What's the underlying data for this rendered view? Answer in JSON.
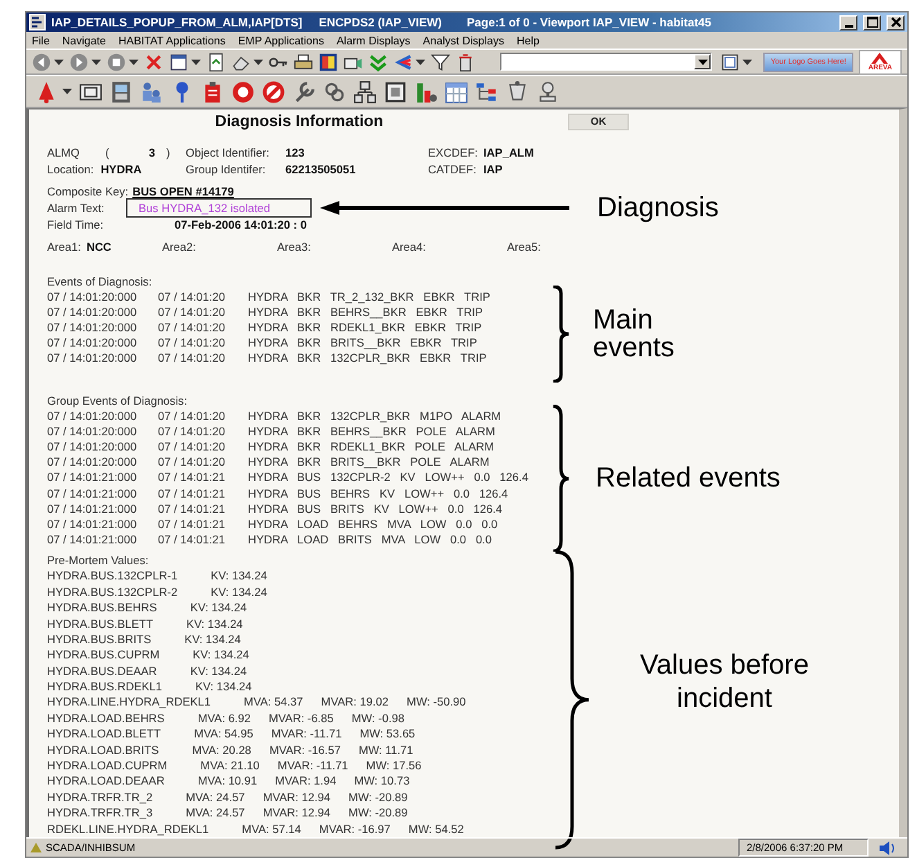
{
  "window": {
    "title": "IAP_DETAILS_POPUP_FROM_ALM,IAP[DTS]",
    "view": "ENCPDS2 (IAP_VIEW)",
    "page_info": "Page:1 of 0  - Viewport IAP_VIEW - habitat45"
  },
  "menu": [
    "File",
    "Navigate",
    "HABITAT Applications",
    "EMP Applications",
    "Alarm Displays",
    "Analyst Displays",
    "Help"
  ],
  "toolbar": {
    "logo_text": "Your Logo Goes Here!",
    "brand": "AREVA"
  },
  "dialog": {
    "title": "Diagnosis Information",
    "ok_button": "OK",
    "identifiers": [
      [
        {
          "label": "ALMQ",
          "open": "(",
          "value": "3",
          "close": ")"
        },
        {
          "label": "Object Identifier:",
          "value": "123"
        },
        {
          "label": "EXCDEF:",
          "value": "IAP_ALM"
        }
      ],
      [
        {
          "label": "Location:",
          "value": "HYDRA"
        },
        {
          "label": "Group Identifer:",
          "value": "62213505051"
        },
        {
          "label": "CATDEF:",
          "value": "IAP"
        }
      ]
    ],
    "composite_key": {
      "label": "Composite Key:",
      "value": "BUS OPEN #14179"
    },
    "alarm_text": {
      "label": "Alarm Text:",
      "value": "Bus HYDRA_132  isolated",
      "annotation": {
        "kind": "arrow",
        "label": "Diagnosis"
      }
    },
    "field_time": {
      "label": "Field Time:",
      "value": "07-Feb-2006 14:01:20 : 0"
    },
    "areas": [
      {
        "label": "Area1:",
        "value": "NCC"
      },
      {
        "label": "Area2:"
      },
      {
        "label": "Area3:"
      },
      {
        "label": "Area4:"
      },
      {
        "label": "Area5:"
      }
    ],
    "sections": [
      {
        "title": "Events of Diagnosis:",
        "kind": "events",
        "annotation": {
          "kind": "brace",
          "label": "Main events"
        },
        "rows": [
          [
            "07 / 14:01:20:000",
            "07 / 14:01:20",
            "HYDRA   BKR   TR_2_132_BKR   EBKR   TRIP"
          ],
          [
            "07 / 14:01:20:000",
            "07 / 14:01:20",
            "HYDRA   BKR   BEHRS__BKR   EBKR   TRIP"
          ],
          [
            "07 / 14:01:20:000",
            "07 / 14:01:20",
            "HYDRA   BKR   RDEKL1_BKR   EBKR   TRIP"
          ],
          [
            "07 / 14:01:20:000",
            "07 / 14:01:20",
            "HYDRA   BKR   BRITS__BKR   EBKR   TRIP"
          ],
          [
            "07 / 14:01:20:000",
            "07 / 14:01:20",
            "HYDRA   BKR   132CPLR_BKR   EBKR   TRIP"
          ]
        ]
      },
      {
        "title": "Group Events of Diagnosis:",
        "kind": "events",
        "annotation": {
          "kind": "brace",
          "label": "Related events"
        },
        "rows": [
          [
            "07 / 14:01:20:000",
            "07 / 14:01:20",
            "HYDRA   BKR   132CPLR_BKR   M1PO   ALARM"
          ],
          [
            "07 / 14:01:20:000",
            "07 / 14:01:20",
            "HYDRA   BKR   BEHRS__BKR   POLE   ALARM"
          ],
          [
            "07 / 14:01:20:000",
            "07 / 14:01:20",
            "HYDRA   BKR   RDEKL1_BKR   POLE   ALARM"
          ],
          [
            "07 / 14:01:20:000",
            "07 / 14:01:20",
            "HYDRA   BKR   BRITS__BKR   POLE   ALARM"
          ],
          [
            "07 / 14:01:21:000",
            "07 / 14:01:21",
            "HYDRA   BUS   132CPLR-2   KV   LOW++   0.0   126.4"
          ],
          [
            "07 / 14:01:21:000",
            "07 / 14:01:21",
            "HYDRA   BUS   BEHRS   KV   LOW++   0.0   126.4"
          ],
          [
            "07 / 14:01:21:000",
            "07 / 14:01:21",
            "HYDRA   BUS   BRITS   KV   LOW++   0.0   126.4"
          ],
          [
            "07 / 14:01:21:000",
            "07 / 14:01:21",
            "HYDRA   LOAD   BEHRS   MVA   LOW   0.0   0.0"
          ],
          [
            "07 / 14:01:21:000",
            "07 / 14:01:21",
            "HYDRA   LOAD   BRITS   MVA   LOW   0.0   0.0"
          ]
        ]
      },
      {
        "title": "Pre-Mortem Values:",
        "kind": "values",
        "annotation": {
          "kind": "brace",
          "label": "Values before incident"
        },
        "rows": [
          [
            "HYDRA.BUS.132CPLR-1",
            "KV: 134.24"
          ],
          [
            "HYDRA.BUS.132CPLR-2",
            "KV: 134.24"
          ],
          [
            "HYDRA.BUS.BEHRS",
            "KV: 134.24"
          ],
          [
            "HYDRA.BUS.BLETT",
            "KV: 134.24"
          ],
          [
            "HYDRA.BUS.BRITS",
            "KV: 134.24"
          ],
          [
            "HYDRA.BUS.CUPRM",
            "KV: 134.24"
          ],
          [
            "HYDRA.BUS.DEAAR",
            "KV: 134.24"
          ],
          [
            "HYDRA.BUS.RDEKL1",
            "KV: 134.24"
          ],
          [
            "HYDRA.LINE.HYDRA_RDEKL1",
            "MVA: 54.37",
            "MVAR: 19.02",
            "MW: -50.90"
          ],
          [
            "HYDRA.LOAD.BEHRS",
            "MVA: 6.92",
            "MVAR: -6.85",
            "MW: -0.98"
          ],
          [
            "HYDRA.LOAD.BLETT",
            "MVA: 54.95",
            "MVAR: -11.71",
            "MW: 53.65"
          ],
          [
            "HYDRA.LOAD.BRITS",
            "MVA: 20.28",
            "MVAR: -16.57",
            "MW: 11.71"
          ],
          [
            "HYDRA.LOAD.CUPRM",
            "MVA: 21.10",
            "MVAR: -11.71",
            "MW: 17.56"
          ],
          [
            "HYDRA.LOAD.DEAAR",
            "MVA: 10.91",
            "MVAR: 1.94",
            "MW: 10.73"
          ],
          [
            "HYDRA.TRFR.TR_2",
            "MVA: 24.57",
            "MVAR: 12.94",
            "MW: -20.89"
          ],
          [
            "HYDRA.TRFR.TR_3",
            "MVA: 24.57",
            "MVAR: 12.94",
            "MW: -20.89"
          ],
          [
            "RDEKL.LINE.HYDRA_RDEKL1",
            "MVA: 57.14",
            "MVAR: -16.97",
            "MW: 54.52"
          ]
        ]
      }
    ]
  },
  "status_bar": {
    "text": "SCADA/INHIBSUM",
    "time": "2/8/2006 6:37:20 PM"
  }
}
